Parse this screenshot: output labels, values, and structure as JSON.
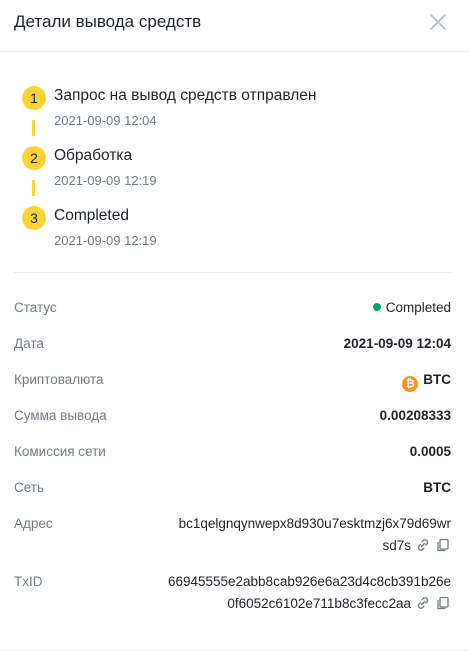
{
  "header": {
    "title": "Детали вывода средств"
  },
  "steps": [
    {
      "number": "1",
      "title": "Запрос на вывод средств отправлен",
      "time": "2021-09-09 12:04"
    },
    {
      "number": "2",
      "title": "Обработка",
      "time": "2021-09-09 12:19"
    },
    {
      "number": "3",
      "title": "Completed",
      "time": "2021-09-09 12:19"
    }
  ],
  "details": {
    "status": {
      "label": "Статус",
      "value": "Completed"
    },
    "date": {
      "label": "Дата",
      "value": "2021-09-09 12:04"
    },
    "crypto": {
      "label": "Криптовалюта",
      "value": "BTC",
      "icon_glyph": "₿"
    },
    "amount": {
      "label": "Сумма вывода",
      "value": "0.00208333"
    },
    "fee": {
      "label": "Комиссия сети",
      "value": "0.0005"
    },
    "network": {
      "label": "Сеть",
      "value": "BTC"
    },
    "address": {
      "label": "Адрес",
      "line1": "bc1qelgnqynwepx8d930u7esktmzj6x79d69wr",
      "line2": "sd7s"
    },
    "txid": {
      "label": "TxID",
      "line1": "66945555e2abb8cab926e6a23d4c8cb391b26e",
      "line2": "0f6052c6102e711b8c3fecc2aa"
    }
  },
  "colors": {
    "accent": "#fcd535",
    "success": "#03a66d",
    "btc": "#f7931a",
    "muted_text": "#707a8a",
    "primary_text": "#1e2329"
  },
  "icons": [
    "close-icon",
    "link-icon",
    "copy-icon",
    "btc-coin-icon",
    "status-dot-icon"
  ]
}
